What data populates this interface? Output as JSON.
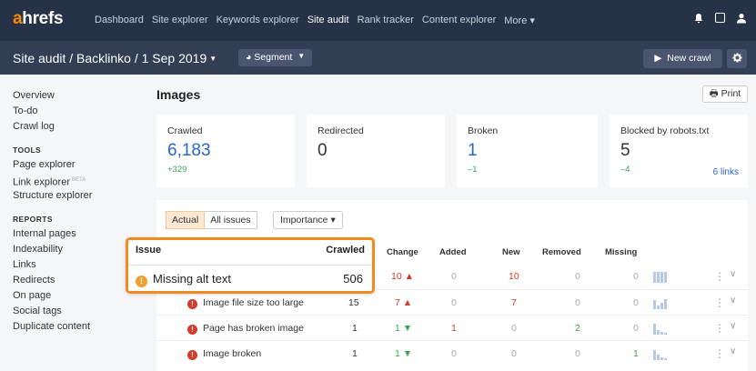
{
  "nav": {
    "logo_a": "a",
    "logo_rest": "hrefs",
    "links": [
      "Dashboard",
      "Site explorer",
      "Keywords explorer",
      "Site audit",
      "Rank tracker",
      "Content explorer",
      "More ▾"
    ],
    "active": "Site audit"
  },
  "subbar": {
    "breadcrumb": "Site audit / Backlinko / 1 Sep 2019",
    "segment_label": "Segment",
    "new_crawl_label": "New crawl"
  },
  "sidebar": {
    "top": [
      "Overview",
      "To-do",
      "Crawl log"
    ],
    "tools_header": "TOOLS",
    "tools": [
      "Page explorer",
      "Link explorer",
      "Structure explorer"
    ],
    "beta": "BETA",
    "reports_header": "REPORTS",
    "reports": [
      "Internal pages",
      "Indexability",
      "Links",
      "Redirects",
      "On page",
      "Social tags",
      "Duplicate content"
    ]
  },
  "page": {
    "title": "Images",
    "print_label": "Print"
  },
  "cards": [
    {
      "label": "Crawled",
      "value": "6,183",
      "delta": "+329"
    },
    {
      "label": "Redirected",
      "value": "0",
      "delta": ""
    },
    {
      "label": "Broken",
      "value": "1",
      "delta": "–1"
    },
    {
      "label": "Blocked by robots.txt",
      "value": "5",
      "delta": "–4",
      "link": "6 links"
    }
  ],
  "filters": {
    "tab_actual": "Actual",
    "tab_all": "All issues",
    "importance": "Importance ▾"
  },
  "table": {
    "headers": {
      "issue": "Issue",
      "crawled": "Crawled",
      "change": "Change",
      "added": "Added",
      "new": "New",
      "removed": "Removed",
      "missing": "Missing"
    },
    "rows": [
      {
        "issue": "Missing alt text",
        "crawled": "506",
        "change": "10 ▲",
        "added": "0",
        "new": "10",
        "removed": "0",
        "missing": "0",
        "level": "warn"
      },
      {
        "issue": "Image file size too large",
        "crawled": "15",
        "change": "7 ▲",
        "added": "0",
        "new": "7",
        "removed": "0",
        "missing": "0",
        "level": "error"
      },
      {
        "issue": "Page has broken image",
        "crawled": "1",
        "change": "1 ▼",
        "added": "1",
        "new": "0",
        "removed": "2",
        "missing": "0",
        "level": "error"
      },
      {
        "issue": "Image broken",
        "crawled": "1",
        "change": "1 ▼",
        "added": "0",
        "new": "0",
        "removed": "0",
        "missing": "1",
        "level": "error"
      }
    ]
  },
  "colors": {
    "accent": "#f08c1f",
    "nav": "#263248",
    "link": "#2867c4",
    "error": "#d43b2a",
    "ok": "#3aa655"
  }
}
